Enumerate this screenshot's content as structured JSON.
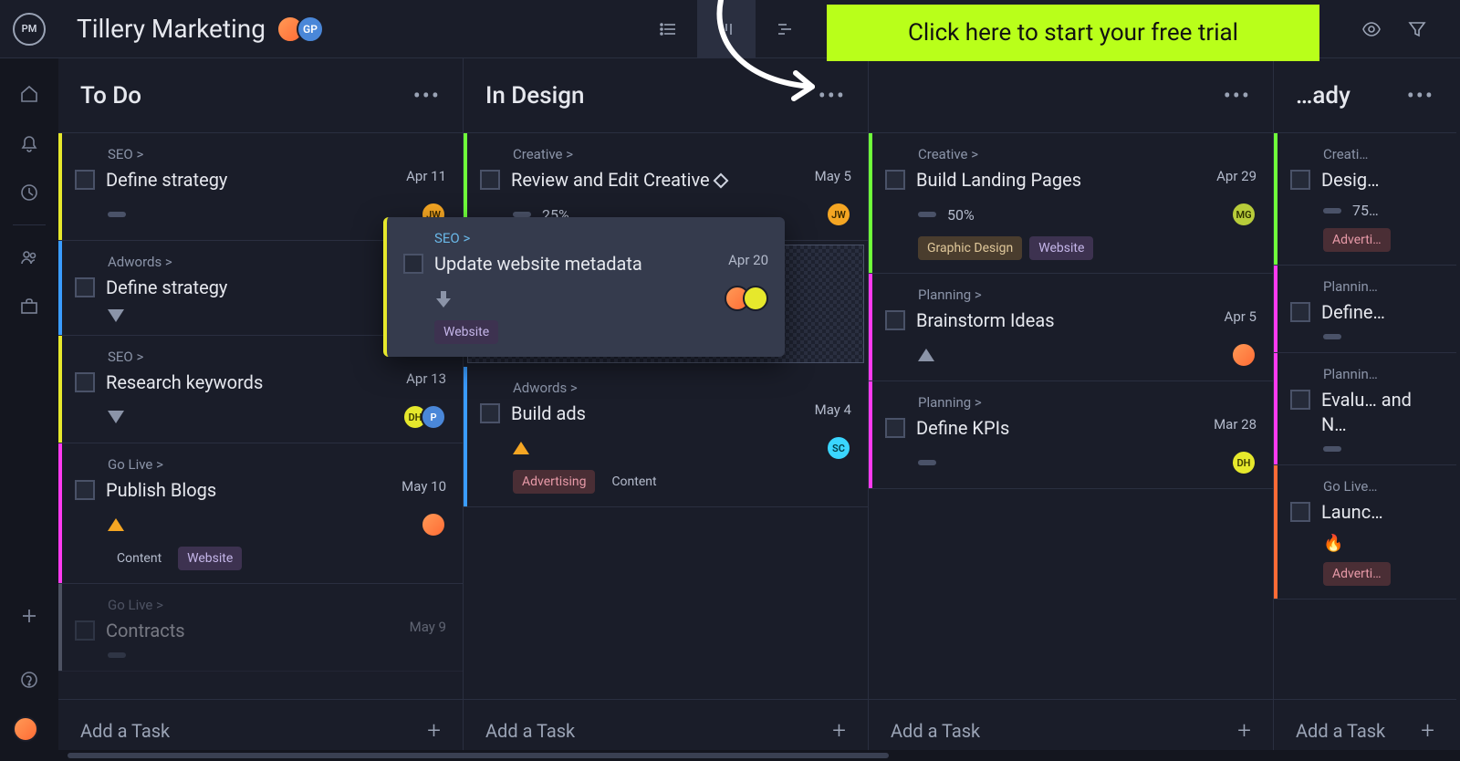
{
  "project_title": "Tillery Marketing",
  "logo_text": "PM",
  "cta_text": "Click here to start your free trial",
  "add_task_label": "Add a Task",
  "header_avatars": [
    {
      "type": "persona"
    },
    {
      "type": "initials",
      "text": "GP",
      "bg": "#4a87d8",
      "fg": "#ffffff"
    }
  ],
  "columns": [
    {
      "title": "To Do",
      "cards": [
        {
          "stripe": "#e6e82c",
          "category": "SEO >",
          "title": "Define strategy",
          "date": "Apr 11",
          "progress": "",
          "priority": "none",
          "avatars": [
            {
              "text": "JW",
              "bg": "#f5a623",
              "fg": "#3b2a00"
            }
          ],
          "tags": []
        },
        {
          "stripe": "#3a9cff",
          "category": "Adwords >",
          "title": "Define strategy",
          "date": "",
          "progress": "",
          "priority": "down",
          "avatars": [],
          "tags": []
        },
        {
          "stripe": "#e6e82c",
          "category": "SEO >",
          "title": "Research keywords",
          "date": "Apr 13",
          "progress": "",
          "priority": "down",
          "avatars": [
            {
              "text": "DH",
              "bg": "#e6e82c",
              "fg": "#3b3b00"
            },
            {
              "text": "P",
              "bg": "#4a87d8",
              "fg": "#ffffff"
            }
          ],
          "tags": []
        },
        {
          "stripe": "#ff3af0",
          "category": "Go Live >",
          "title": "Publish Blogs",
          "date": "May 10",
          "progress": "",
          "priority": "up",
          "avatars": [
            {
              "type": "persona"
            }
          ],
          "tags": [
            {
              "text": "Content",
              "style": "gray"
            },
            {
              "text": "Website",
              "style": "purple"
            }
          ]
        },
        {
          "stripe": "#8b94a8",
          "category": "Go Live >",
          "title": "Contracts",
          "date": "May 9",
          "progress": "",
          "priority": "none",
          "avatars": [],
          "tags": [],
          "faded": true
        }
      ]
    },
    {
      "title": "In Design",
      "cards": [
        {
          "stripe": "#6fff3a",
          "category": "Creative >",
          "title": "Review and Edit Creative",
          "diamond": true,
          "date": "May 5",
          "progress": "25%",
          "priority": "none",
          "avatars": [
            {
              "text": "JW",
              "bg": "#f5a623",
              "fg": "#3b2a00"
            }
          ],
          "tags": []
        },
        {
          "dropzone": true
        },
        {
          "stripe": "#3a9cff",
          "category": "Adwords >",
          "title": "Build ads",
          "date": "May 4",
          "progress": "",
          "priority": "up",
          "avatars": [
            {
              "text": "SC",
              "bg": "#3ad6ff",
              "fg": "#003b45"
            }
          ],
          "tags": [
            {
              "text": "Advertising",
              "style": "red"
            },
            {
              "text": "Content",
              "style": "gray"
            }
          ]
        }
      ]
    },
    {
      "title": "",
      "cards": [
        {
          "stripe": "#6fff3a",
          "category": "Creative >",
          "title": "Build Landing Pages",
          "date": "Apr 29",
          "progress": "50%",
          "priority": "none",
          "avatars": [
            {
              "text": "MG",
              "bg": "#b8cc3a",
              "fg": "#2e3300"
            }
          ],
          "tags": [
            {
              "text": "Graphic Design",
              "style": "brown"
            },
            {
              "text": "Website",
              "style": "purple"
            }
          ]
        },
        {
          "stripe": "#ff3af0",
          "category": "Planning >",
          "title": "Brainstorm Ideas",
          "date": "Apr 5",
          "progress": "",
          "priority": "up-gray",
          "avatars": [
            {
              "type": "persona"
            }
          ],
          "tags": []
        },
        {
          "stripe": "#ff3af0",
          "category": "Planning >",
          "title": "Define KPIs",
          "date": "Mar 28",
          "progress": "",
          "priority": "none",
          "avatars": [
            {
              "text": "DH",
              "bg": "#e6e82c",
              "fg": "#3b3b00"
            }
          ],
          "tags": []
        }
      ]
    },
    {
      "title": "…ady",
      "cards": [
        {
          "stripe": "#6fff3a",
          "category": "Creati…",
          "title": "Desig…",
          "date": "",
          "progress": "75…",
          "priority": "none",
          "avatars": [],
          "tags": [
            {
              "text": "Adverti…",
              "style": "red"
            }
          ]
        },
        {
          "stripe": "#ff3af0",
          "category": "Plannin…",
          "title": "Define…",
          "date": "",
          "progress": "",
          "priority": "none",
          "avatars": [],
          "tags": []
        },
        {
          "stripe": "#ff3af0",
          "category": "Plannin…",
          "title": "Evalu…\nand N…",
          "date": "",
          "progress": "",
          "priority": "none",
          "avatars": [],
          "tags": []
        },
        {
          "stripe": "#ff6b35",
          "category": "Go Live…",
          "title": "Launc…",
          "date": "",
          "progress": "",
          "priority": "flame",
          "avatars": [],
          "tags": [
            {
              "text": "Adverti…",
              "style": "red"
            }
          ]
        }
      ]
    }
  ],
  "dragging_card": {
    "category": "SEO >",
    "title": "Update website metadata",
    "date": "Apr 20",
    "avatars": [
      {
        "type": "persona"
      },
      {
        "text": "",
        "bg": "#e6e82c",
        "fg": "#3b3b00"
      }
    ],
    "tags": [
      {
        "text": "Website",
        "style": "purple"
      }
    ]
  }
}
